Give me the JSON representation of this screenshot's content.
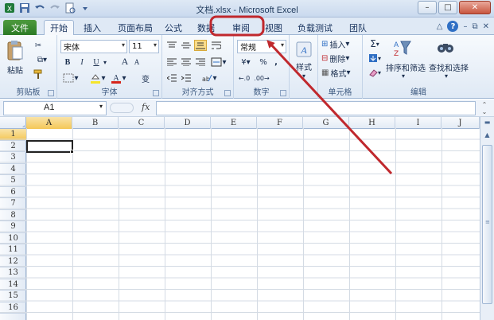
{
  "window": {
    "title": "文档.xlsx - Microsoft Excel",
    "minimize": "–",
    "maximize": "□",
    "close": "✕"
  },
  "tabs": {
    "file": "文件",
    "items": [
      {
        "label": "开始",
        "active": true
      },
      {
        "label": "插入"
      },
      {
        "label": "页面布局"
      },
      {
        "label": "公式"
      },
      {
        "label": "数据"
      },
      {
        "label": "审阅",
        "highlighted": true
      },
      {
        "label": "视图"
      },
      {
        "label": "负载测试"
      },
      {
        "label": "团队"
      }
    ]
  },
  "ribbon": {
    "clipboard": {
      "label": "剪贴板",
      "paste": "粘贴"
    },
    "font": {
      "label": "字体",
      "name": "宋体",
      "size": "11",
      "bold": "B",
      "italic": "I",
      "underline": "U",
      "grow": "A",
      "shrink": "A",
      "color": "A",
      "phonetic": "变"
    },
    "alignment": {
      "label": "对齐方式"
    },
    "number": {
      "label": "数字",
      "format": "常规",
      "currency": "¥",
      "percent": "%",
      "comma": ","
    },
    "styles": {
      "label": "样式"
    },
    "cells": {
      "label": "单元格",
      "insert": "插入",
      "delete": "删除",
      "format": "格式"
    },
    "editing": {
      "label": "编辑",
      "sum": "Σ",
      "sort_filter": "排序和筛选",
      "find_select": "查找和选择"
    }
  },
  "formula_bar": {
    "name_box": "A1",
    "fx": "fx",
    "content": ""
  },
  "sheet": {
    "columns": [
      "A",
      "B",
      "C",
      "D",
      "E",
      "F",
      "G",
      "H",
      "I",
      "J"
    ],
    "rows": [
      "1",
      "2",
      "3",
      "4",
      "5",
      "6",
      "7",
      "8",
      "9",
      "10",
      "11",
      "12",
      "13",
      "14",
      "15",
      "16"
    ],
    "active_cell": "A1"
  },
  "colors": {
    "file_tab": "#2b7a25",
    "annotation": "#c0282d",
    "selection": "#f4c757"
  }
}
